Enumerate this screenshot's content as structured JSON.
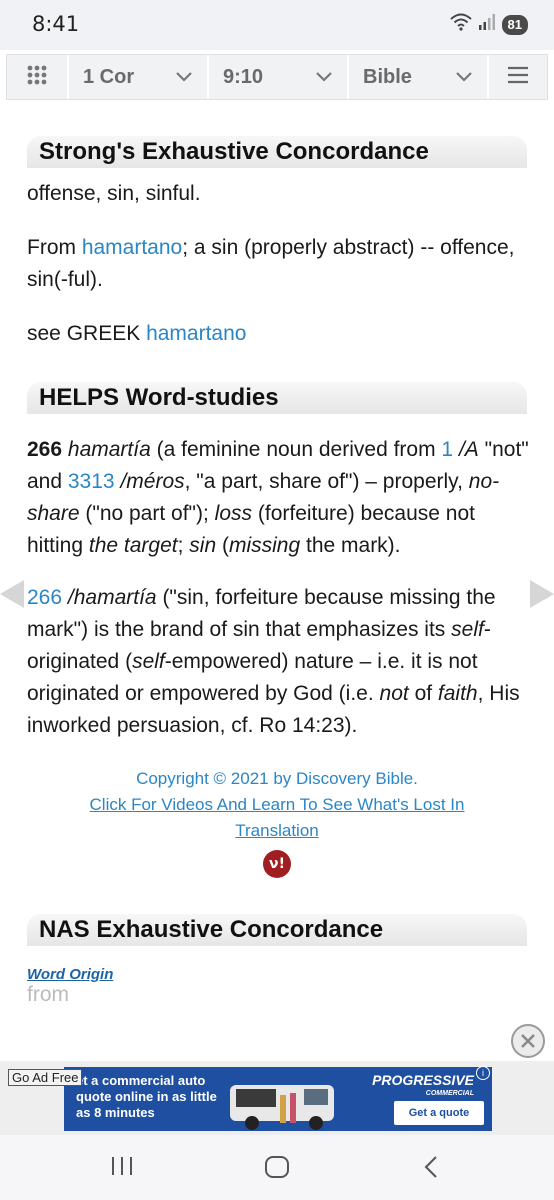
{
  "status": {
    "time": "8:41",
    "signal_label": "6",
    "battery": "81"
  },
  "nav": {
    "book": "1 Cor",
    "chapter": "9:10",
    "version": "Bible"
  },
  "strongs": {
    "heading": "Strong's Exhaustive Concordance",
    "definition": "offense, sin, sinful.",
    "from_prefix": "From ",
    "from_link": "hamartano",
    "from_rest": "; a sin (properly abstract) -- offence, sin(-ful).",
    "see_prefix": "see GREEK ",
    "see_link": "hamartano"
  },
  "helps": {
    "heading": "HELPS Word-studies",
    "p1": {
      "num": "266",
      "word": "hamartía",
      "t1": " (a feminine noun derived from ",
      "link1": "1",
      "t2": "/A",
      "t3": " \"not\" and ",
      "link2": "3313",
      "t4": "/méros",
      "t5": ", \"a part, share of\") – properly, ",
      "t6": "no-share",
      "t7": " (\"no part of\"); ",
      "t8": "loss",
      "t9": " (forfeiture) because not hitting ",
      "t10": "the target",
      "t11": "; ",
      "t12": "sin",
      "t13": " (",
      "t14": "missing",
      "t15": " the mark)."
    },
    "p2": {
      "link": "266",
      "word": "/hamartía",
      "t1": " (\"sin, forfeiture because missing the mark\") is the brand of sin that emphasizes its ",
      "t2": "self",
      "t3": "-originated (",
      "t4": "self",
      "t5": "-empowered) nature – i.e. it is not originated or empowered by God (i.e. ",
      "t6": "not",
      "t7": " of ",
      "t8": "faith",
      "t9": ", His inworked persuasion, cf. Ro 14:23)."
    },
    "copyright": "Copyright © 2021 by Discovery Bible.",
    "click_link": "Click For Videos And Learn To See What's Lost In Translation",
    "logo_text": "ν!"
  },
  "nas": {
    "heading": "NAS Exhaustive Concordance",
    "word_origin": "Word Origin",
    "faded": "from"
  },
  "ad": {
    "go_adfree": "Go Ad Free",
    "text": "et a commercial auto quote online in as little as 8 minutes",
    "brand": "PROGRESSIVE",
    "brand_sub": "COMMERCIAL",
    "cta": "Get a quote",
    "info": "i"
  },
  "icons": [
    "wifi-icon",
    "signal-icon",
    "grid-icon",
    "chevron-down-icon",
    "menu-icon",
    "prev-arrow-icon",
    "next-arrow-icon",
    "close-icon",
    "recents-icon",
    "home-icon",
    "back-icon"
  ]
}
